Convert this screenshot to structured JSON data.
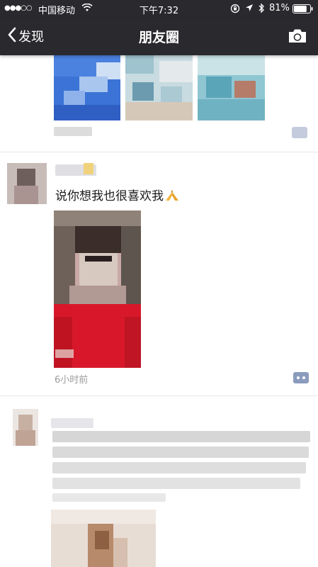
{
  "status_bar": {
    "signal_dots": "●●●○○",
    "carrier": "中国移动",
    "time": "下午7:32",
    "battery_percent": "81%",
    "battery_level": 0.81
  },
  "nav": {
    "back_label": "发现",
    "title": "朋友圈"
  },
  "posts": [
    {
      "time": ""
    },
    {
      "text": "说你想我也很喜欢我",
      "time": "6小时前"
    },
    {
      "time": ""
    }
  ],
  "colors": {
    "bar_bg": "#2a292e",
    "comment_icon": "#8a9bbd",
    "post_image_red": "#d8182a"
  }
}
